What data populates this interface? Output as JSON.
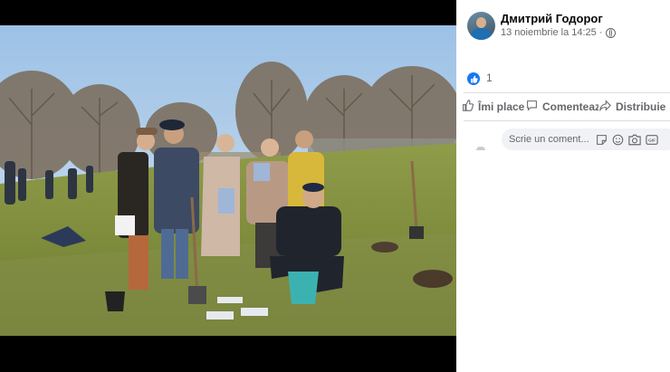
{
  "post": {
    "author": "Дмитрий Годорог",
    "timestamp": "13 noiembrie la 14:25 ·",
    "privacy_icon": "globe-icon",
    "photo_subject": "group of people planting trees in a park"
  },
  "reactions": {
    "icon": "thumbs-up-icon",
    "count": "1"
  },
  "actions": {
    "like": "Îmi place",
    "comment": "Comentează",
    "share": "Distribuie"
  },
  "comment_input": {
    "placeholder": "Scrie un coment...",
    "icons": [
      "sticker-icon",
      "emoji-icon",
      "camera-icon",
      "gif-icon"
    ]
  },
  "colors": {
    "accent": "#1877f2",
    "secondary_text": "#65676b",
    "input_bg": "#f0f2f5"
  }
}
